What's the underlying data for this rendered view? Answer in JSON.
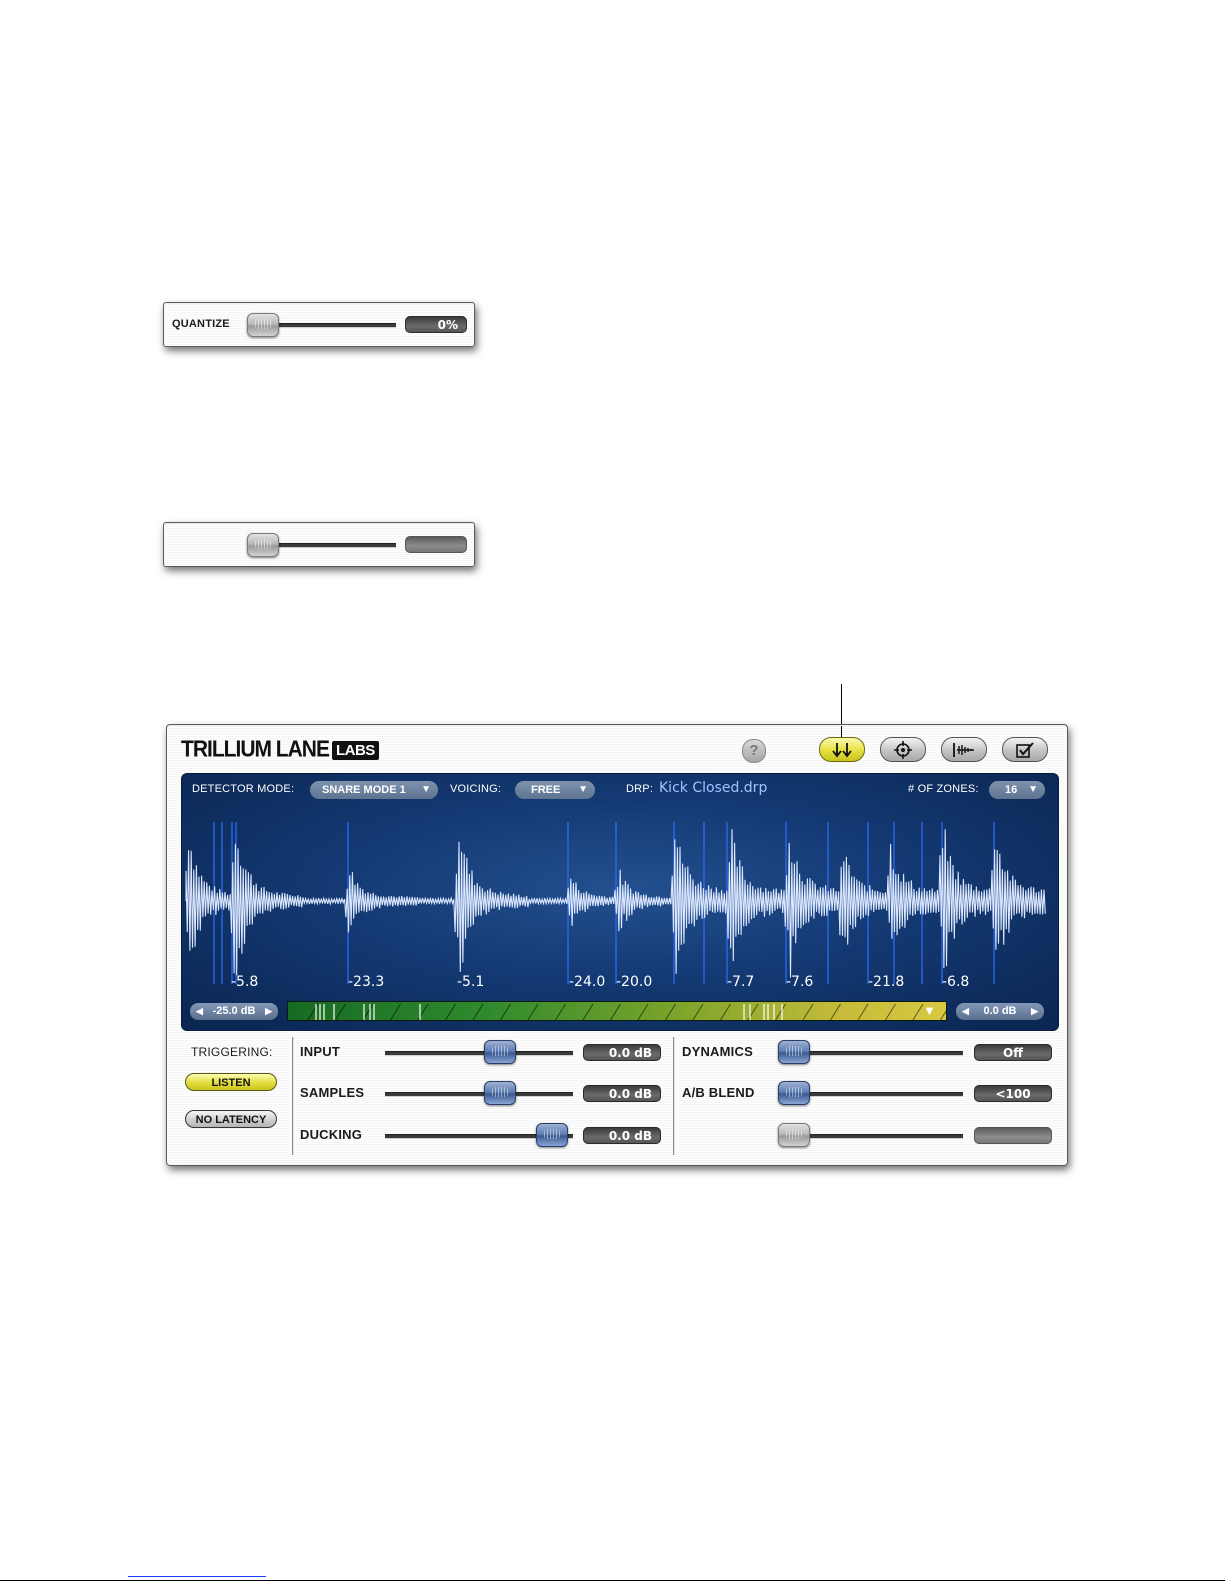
{
  "quantize_strip": {
    "label": "QUANTIZE",
    "value": "0%"
  },
  "brand": {
    "name": "TRILLIUM LANE",
    "badge": "LABS"
  },
  "toolbar": {
    "help": "?",
    "buttons": [
      {
        "icon": "trigger-arrows-icon",
        "active": true
      },
      {
        "icon": "crosshair-icon",
        "active": false
      },
      {
        "icon": "waveform-icon",
        "active": false
      },
      {
        "icon": "checkbox-edit-icon",
        "active": false
      }
    ]
  },
  "detector": {
    "mode_label": "DETECTOR MODE:",
    "mode_value": "SNARE MODE 1",
    "voicing_label": "VOICING:",
    "voicing_value": "FREE",
    "drp_label": "DRP:",
    "drp_value": "Kick Closed.drp",
    "zones_label": "# OF ZONES:",
    "zones_value": "16"
  },
  "hit_values": [
    "-5.8",
    "-23.3",
    "-5.1",
    "-24.0",
    "-20.0",
    "-7.7",
    "-7.6",
    "-21.8",
    "-6.8"
  ],
  "threshold": {
    "left_db": "-25.0 dB",
    "right_db": "0.0 dB"
  },
  "triggering": {
    "label": "TRIGGERING:",
    "listen": "LISTEN",
    "no_latency": "NO LATENCY"
  },
  "sliders_left": [
    {
      "label": "INPUT",
      "value": "0.0 dB"
    },
    {
      "label": "SAMPLES",
      "value": "0.0 dB"
    },
    {
      "label": "DUCKING",
      "value": "0.0 dB"
    }
  ],
  "sliders_right": [
    {
      "label": "DYNAMICS",
      "value": "Off"
    },
    {
      "label": "A/B BLEND",
      "value": "<100"
    }
  ],
  "colors": {
    "accent_yellow": "#e4e040",
    "waveform_bg": "#0d2a5a",
    "marker_blue": "#2f6dff"
  }
}
